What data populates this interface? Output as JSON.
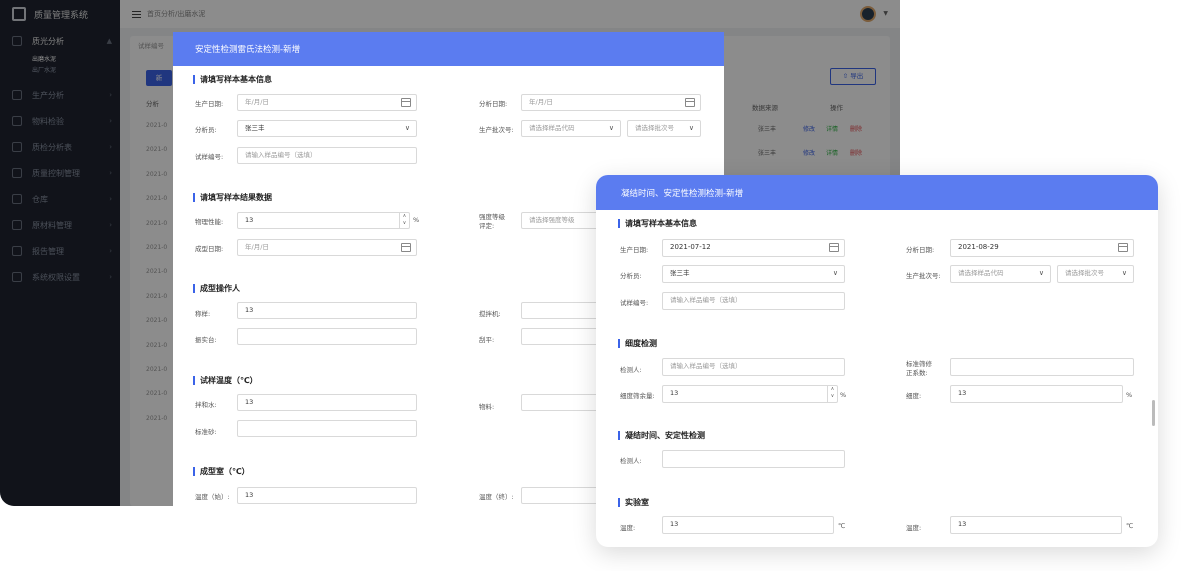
{
  "app": {
    "title": "质量管理系统",
    "breadcrumb": "首页分析/出磨水泥",
    "sidebar": {
      "open_group": "质光分析",
      "sub_items": [
        "出磨水泥",
        "出厂水泥"
      ],
      "groups": [
        "生产分析",
        "物料检验",
        "质检分析表",
        "质量控制管理",
        "仓库",
        "原材料管理",
        "报告管理",
        "系统权限设置"
      ]
    },
    "bg_filter_label": "试样编号",
    "bg_button": "新",
    "bg_export": "导出",
    "bg_table_header": [
      "分析",
      "数据来源",
      "操作"
    ],
    "bg_rows": [
      "2021-0",
      "2021-0",
      "2021-0",
      "2021-0",
      "2021-0",
      "2021-0",
      "2021-0",
      "2021-0",
      "2021-0",
      "2021-0",
      "2021-0",
      "2021-0",
      "2021-0"
    ],
    "bg_source": "张三丰",
    "bg_actions": [
      "修改",
      "详情",
      "删除"
    ]
  },
  "modal1": {
    "title": "安定性检测雷氏法检测-新增",
    "sec_basic": "请填写样本基本信息",
    "prod_date_label": "生产日期:",
    "prod_date_ph": "年/月/日",
    "analysis_date_label": "分析日期:",
    "analysis_date_ph": "年/月/日",
    "analyst_label": "分析员:",
    "analyst_val": "张三丰",
    "batch_label": "生产批次号:",
    "batch_ph1": "请选择样品代码",
    "batch_ph2": "请选择批次号",
    "sample_no_label": "试样编号:",
    "sample_no_ph": "请输入样品编号（选填）",
    "sec_result": "请填写样本结果数据",
    "phys_label": "物理性能:",
    "phys_val": "13",
    "phys_unit": "%",
    "strength_label1": "强度等级",
    "strength_label2": "评定:",
    "strength_ph": "请选择强度等级",
    "mold_date_label": "成型日期:",
    "mold_date_ph": "年/月/日",
    "sec_op": "成型操作人",
    "weigh_label": "称样:",
    "weigh_val": "13",
    "mixer_label": "搅拌机:",
    "vibe_label": "振实台:",
    "scrape_label": "刮平:",
    "sec_temp": "试样温度（℃）",
    "water_label": "拌和水:",
    "water_val": "13",
    "material_label": "物料:",
    "sand_label": "标准砂:",
    "sec_room": "成型室（℃）",
    "temp_start_label": "温度（始）:",
    "temp_start_val": "13",
    "temp_end_label": "温度（终）:"
  },
  "modal2": {
    "title": "凝结时间、安定性检测检测-新增",
    "sec_basic": "请填写样本基本信息",
    "prod_date_label": "生产日期:",
    "prod_date_val": "2021-07-12",
    "analysis_date_label": "分析日期:",
    "analysis_date_val": "2021-08-29",
    "analyst_label": "分析员:",
    "analyst_val": "张三丰",
    "batch_label": "生产批次号:",
    "batch_ph1": "请选择样品代码",
    "batch_ph2": "请选择批次号",
    "sample_no_label": "试样编号:",
    "sample_no_ph": "请输入样品编号（选填）",
    "sec_fine": "细度检测",
    "inspector_label": "检测人:",
    "inspector_ph": "请输入样品编号（选填）",
    "sieve_label1": "标准筛修",
    "sieve_label2": "正系数:",
    "residue_label": "细度筛余量:",
    "residue_val": "13",
    "residue_unit": "%",
    "fineness_label": "细度:",
    "fineness_val": "13",
    "fineness_unit": "%",
    "sec_setting": "凝结时间、安定性检测",
    "inspector2_label": "检测人:",
    "sec_lab": "实验室",
    "temp_label": "温度:",
    "temp_val": "13",
    "temp_unit": "℃",
    "temp2_label": "温度:",
    "temp2_val": "13",
    "temp2_unit": "℃"
  }
}
